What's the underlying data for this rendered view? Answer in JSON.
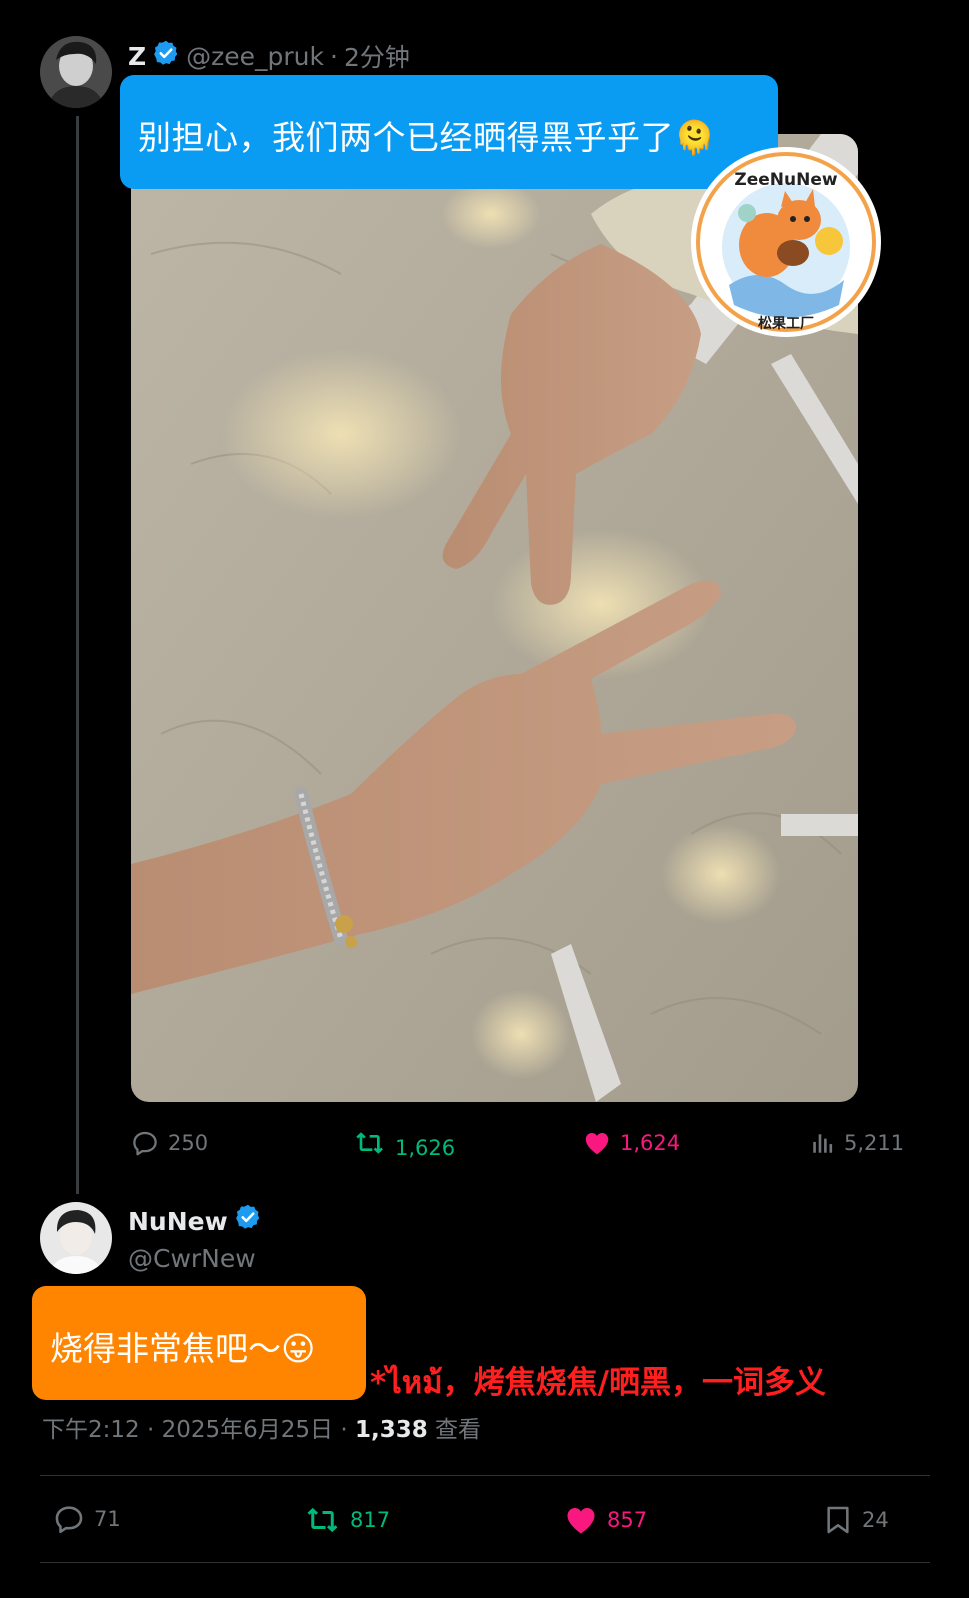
{
  "tweet": {
    "author_name": "Z",
    "handle": "@zee_pruk",
    "separator": "·",
    "time_ago": "2分钟",
    "caption": "别担心，我们两个已经晒得黑乎乎了🫠",
    "stamp_text_top": "ZeeNuNew",
    "stamp_text_bottom": "松果工厂",
    "stats": {
      "replies": "250",
      "retweets": "1,626",
      "likes": "1,624",
      "views": "5,211"
    }
  },
  "reply": {
    "author_name": "NuNew",
    "handle": "@CwrNew",
    "caption": "烧得非常焦吧～😛",
    "note": "*ไหม้，烤焦烧焦/晒黑，一词多义",
    "timestamp": "下午2:12 · 2025年6月25日 · ",
    "views_count": "1,338",
    "views_label": " 查看",
    "stats": {
      "replies": "71",
      "retweets": "817",
      "likes": "857",
      "bookmarks": "24"
    }
  },
  "colors": {
    "background": "#000000",
    "muted": "#71767b",
    "retweet_green": "#00ba7c",
    "like_pink": "#f91880",
    "verified_blue": "#1d9bf0",
    "bubble_blue": "#0a9bf3",
    "bubble_orange": "#ff8400",
    "note_red": "#ff1f1f"
  },
  "icons": [
    "reply-icon",
    "retweet-icon",
    "like-icon",
    "views-icon",
    "bookmark-icon",
    "verified-icon"
  ]
}
